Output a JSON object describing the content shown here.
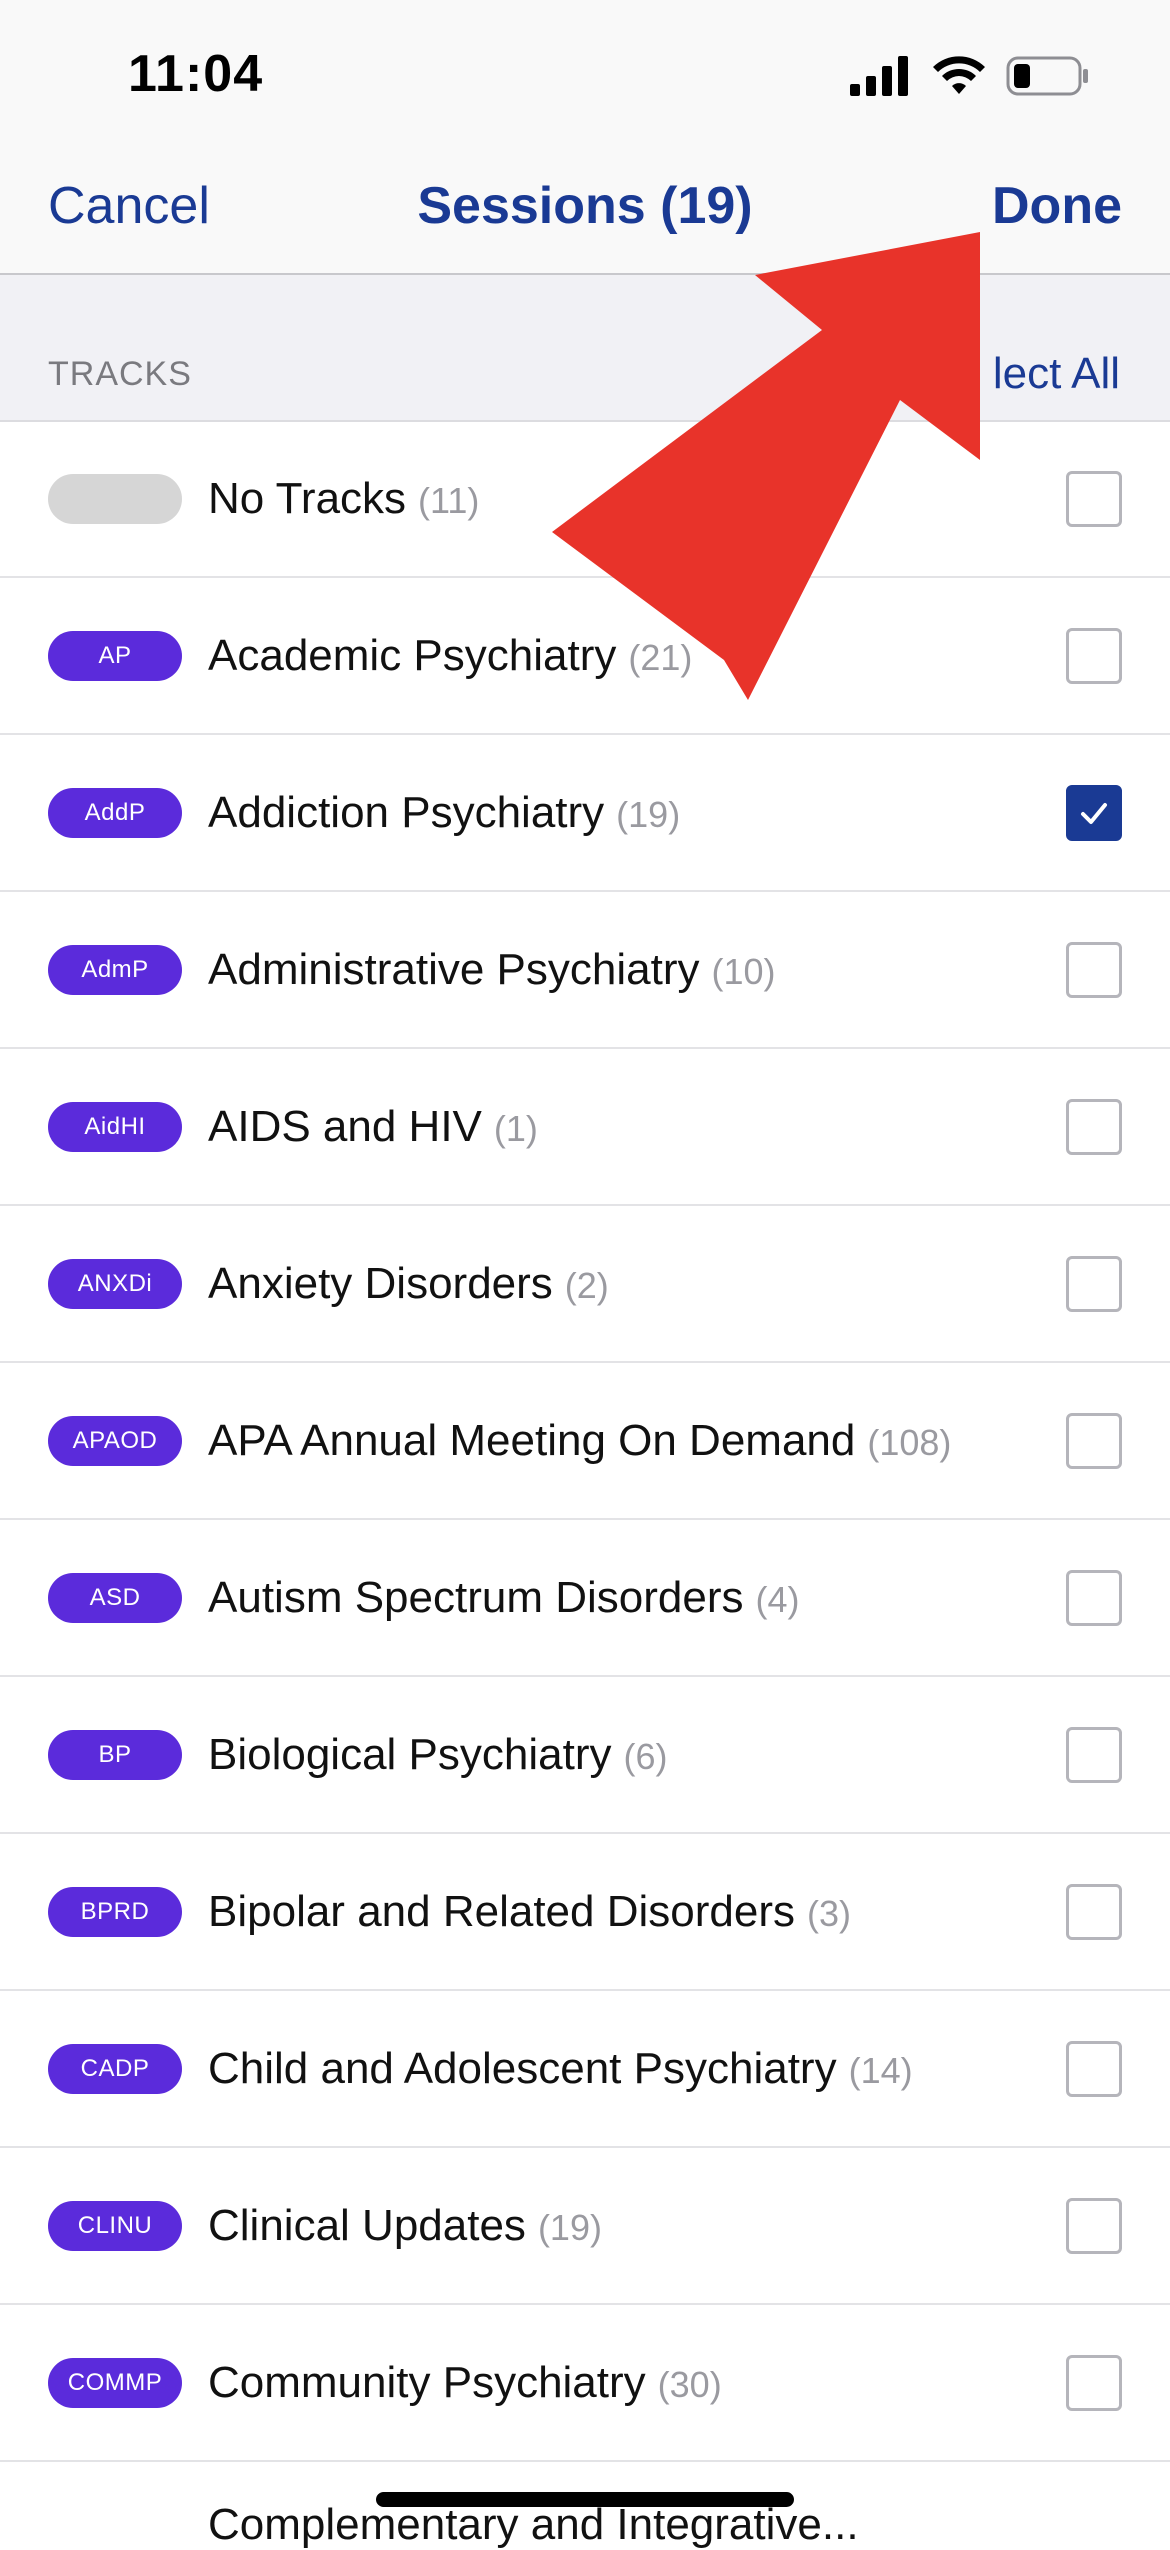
{
  "status": {
    "time": "11:04"
  },
  "nav": {
    "cancel_label": "Cancel",
    "title": "Sessions (19)",
    "done_label": "Done"
  },
  "section": {
    "label": "TRACKS",
    "action_label": "Select All",
    "action_visible_text": "lect All"
  },
  "colors": {
    "accent": "#1a3a94",
    "pill": "#5b2bdb",
    "annotation_arrow": "#e8332a"
  },
  "tracks": [
    {
      "code": "",
      "name": "No Tracks",
      "count": "(11)",
      "checked": false
    },
    {
      "code": "AP",
      "name": "Academic Psychiatry",
      "count": "(21)",
      "checked": false
    },
    {
      "code": "AddP",
      "name": "Addiction Psychiatry",
      "count": "(19)",
      "checked": true
    },
    {
      "code": "AdmP",
      "name": "Administrative Psychiatry",
      "count": "(10)",
      "checked": false
    },
    {
      "code": "AidHI",
      "name": "AIDS and HIV",
      "count": "(1)",
      "checked": false
    },
    {
      "code": "ANXDi",
      "name": "Anxiety Disorders",
      "count": "(2)",
      "checked": false
    },
    {
      "code": "APAOD",
      "name": "APA Annual Meeting On Demand",
      "count": "(108)",
      "checked": false
    },
    {
      "code": "ASD",
      "name": "Autism Spectrum Disorders",
      "count": "(4)",
      "checked": false
    },
    {
      "code": "BP",
      "name": "Biological Psychiatry",
      "count": "(6)",
      "checked": false
    },
    {
      "code": "BPRD",
      "name": "Bipolar and Related Disorders",
      "count": "(3)",
      "checked": false
    },
    {
      "code": "CADP",
      "name": "Child and Adolescent Psychiatry",
      "count": "(14)",
      "checked": false
    },
    {
      "code": "CLINU",
      "name": "Clinical Updates",
      "count": "(19)",
      "checked": false
    },
    {
      "code": "COMMP",
      "name": "Community Psychiatry",
      "count": "(30)",
      "checked": false
    }
  ],
  "partial_row_text": "Complementary and Integrative..."
}
